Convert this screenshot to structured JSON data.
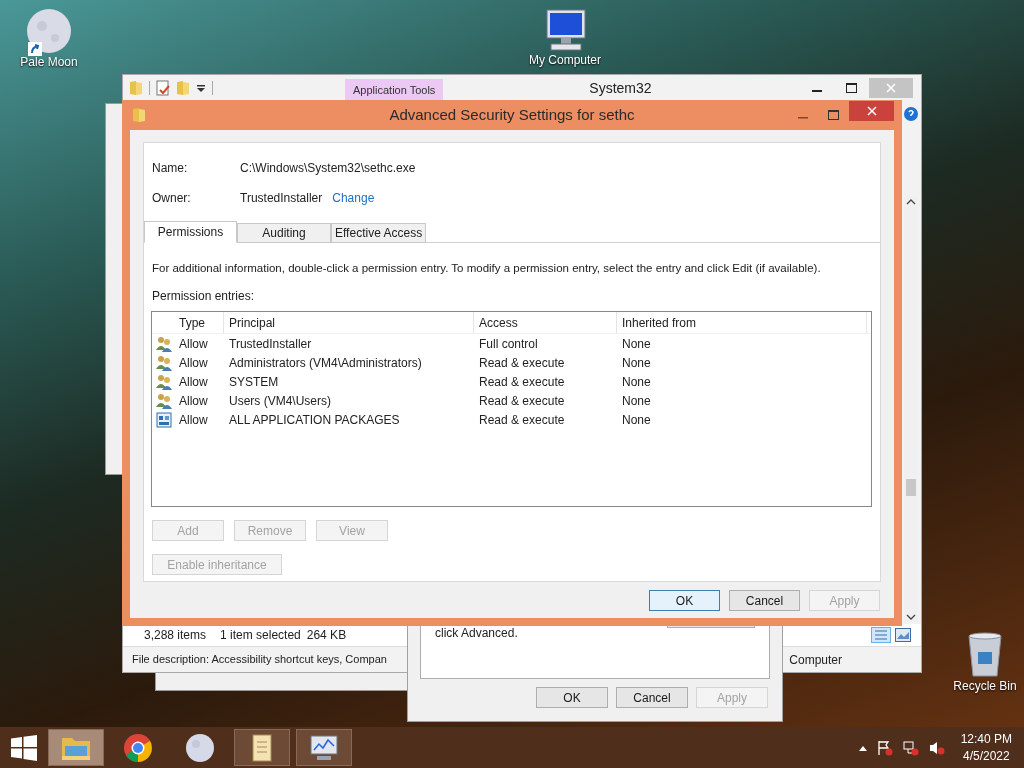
{
  "desktop_icons": [
    {
      "kind": "moon",
      "label": "Pale Moon",
      "shortcut": true
    },
    {
      "kind": "computer",
      "label": "My Computer",
      "shortcut": false
    },
    {
      "kind": "bin",
      "label": "Recycle Bin",
      "shortcut": false
    }
  ],
  "explorer": {
    "title": "System32",
    "context_tab": "Application Tools",
    "status": [
      "3,288 items",
      "1 item selected",
      "264 KB"
    ],
    "details": "File description: Accessibility shortcut keys, Compan",
    "details_right": "Computer"
  },
  "properties": {
    "text": "click Advanced.",
    "buttons": [
      {
        "label": "OK",
        "disabled": false
      },
      {
        "label": "Cancel",
        "disabled": false
      },
      {
        "label": "Apply",
        "disabled": true
      }
    ]
  },
  "dialog": {
    "title": "Advanced Security Settings for sethc",
    "name_label": "Name:",
    "name_value": "C:\\Windows\\System32\\sethc.exe",
    "owner_label": "Owner:",
    "owner_value": "TrustedInstaller",
    "owner_link": "Change",
    "tabs": [
      {
        "label": "Permissions",
        "selected": true
      },
      {
        "label": "Auditing",
        "selected": false
      },
      {
        "label": "Effective Access",
        "selected": false
      }
    ],
    "info": "For additional information, double-click a permission entry. To modify a permission entry, select the entry and click Edit (if available).",
    "entries_label": "Permission entries:",
    "columns": [
      "Type",
      "Principal",
      "Access",
      "Inherited from"
    ],
    "rows": [
      {
        "kind": "users",
        "type": "Allow",
        "principal": "TrustedInstaller",
        "access": "Full control",
        "inherited": "None"
      },
      {
        "kind": "users",
        "type": "Allow",
        "principal": "Administrators (VM4\\Administrators)",
        "access": "Read & execute",
        "inherited": "None"
      },
      {
        "kind": "users",
        "type": "Allow",
        "principal": "SYSTEM",
        "access": "Read & execute",
        "inherited": "None"
      },
      {
        "kind": "users",
        "type": "Allow",
        "principal": "Users (VM4\\Users)",
        "access": "Read & execute",
        "inherited": "None"
      },
      {
        "kind": "package",
        "type": "Allow",
        "principal": "ALL APPLICATION PACKAGES",
        "access": "Read & execute",
        "inherited": "None"
      }
    ],
    "entry_buttons": [
      {
        "label": "Add",
        "disabled": true
      },
      {
        "label": "Remove",
        "disabled": true
      },
      {
        "label": "View",
        "disabled": true
      }
    ],
    "inheritance_button": {
      "label": "Enable inheritance",
      "disabled": true
    },
    "buttons": [
      {
        "label": "OK",
        "disabled": false,
        "default": true
      },
      {
        "label": "Cancel",
        "disabled": false,
        "default": false
      },
      {
        "label": "Apply",
        "disabled": true,
        "default": false
      }
    ]
  },
  "taskbar": {
    "apps": [
      {
        "kind": "explorer",
        "running": true,
        "active": true
      },
      {
        "kind": "chrome",
        "running": false,
        "active": false
      },
      {
        "kind": "moon",
        "running": false,
        "active": false
      },
      {
        "kind": "scroll",
        "running": true,
        "active": false
      },
      {
        "kind": "monitor",
        "running": true,
        "active": false
      }
    ],
    "time": "12:40 PM",
    "date": "4/5/2022"
  }
}
